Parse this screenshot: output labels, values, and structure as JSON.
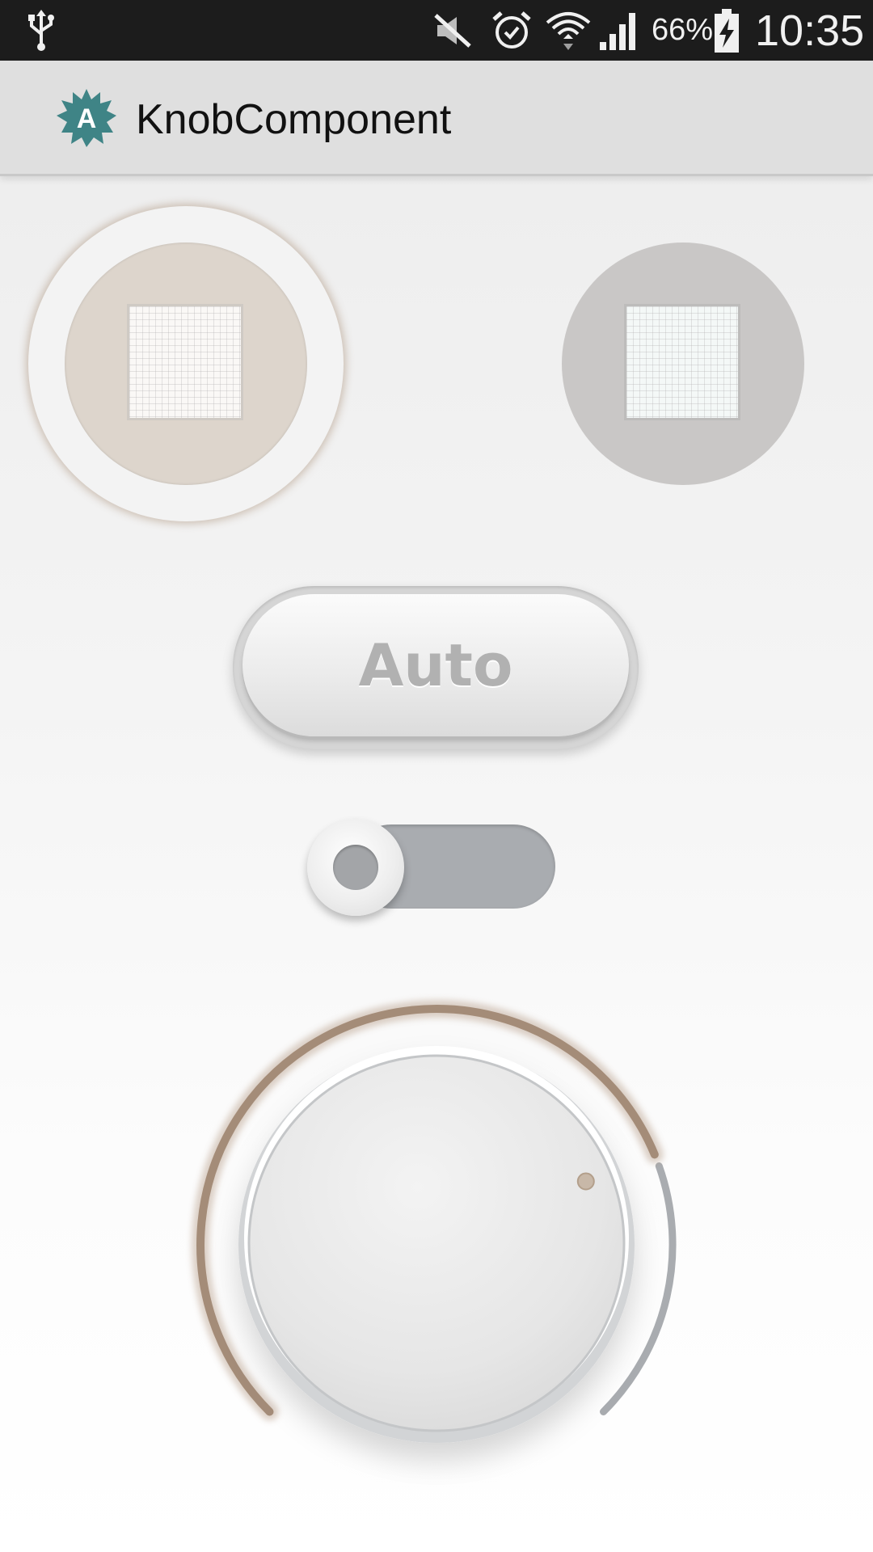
{
  "status_bar": {
    "icons": [
      "usb-icon",
      "mute-icon",
      "alarm-icon",
      "wifi-icon",
      "signal-icon",
      "battery-charging-icon"
    ],
    "battery_percent": "66%",
    "time": "10:35"
  },
  "action_bar": {
    "app_icon": "app-logo-icon",
    "app_icon_letter": "A",
    "title": "KnobComponent"
  },
  "mode_selector": {
    "items": [
      {
        "icon": "grid-panel-icon",
        "selected": true
      },
      {
        "icon": "grid-panel-icon",
        "selected": false
      }
    ]
  },
  "auto_button": {
    "label": "Auto"
  },
  "toggle": {
    "on": false
  },
  "knob": {
    "value_percent": 75
  },
  "colors": {
    "status_bar_bg": "#1c1c1c",
    "action_bar_bg": "#dfdfdf",
    "app_icon_teal": "#3f8486",
    "accent_brown": "#a48c78",
    "track_grey": "#a9acb0",
    "selected_button_fill": "#ddd5cc",
    "unselected_button_fill": "#c9c7c6"
  }
}
